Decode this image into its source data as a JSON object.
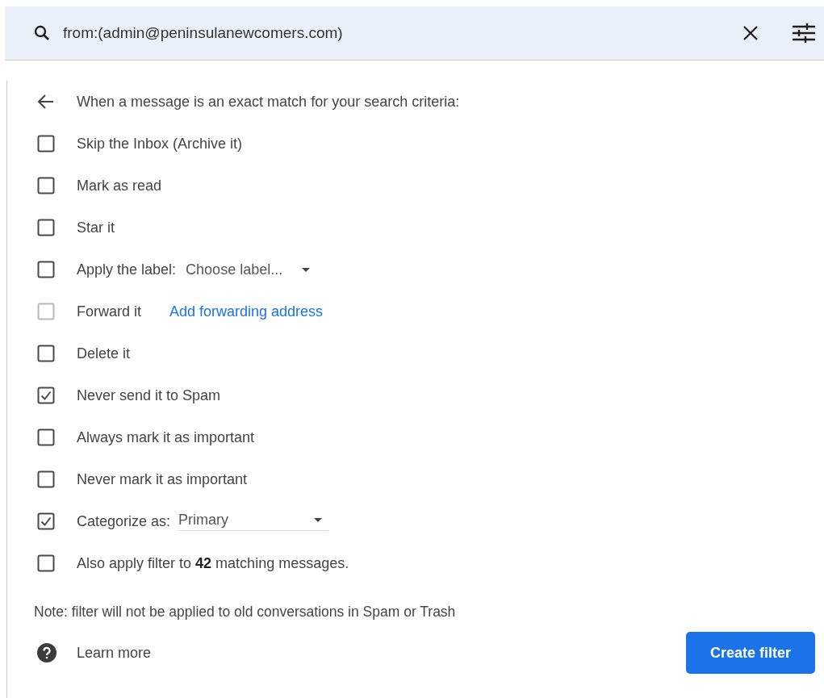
{
  "search": {
    "value": "from:(admin@peninsulanewcomers.com)"
  },
  "header": {
    "text": "When a message is an exact match for your search criteria:"
  },
  "options": [
    {
      "kind": "plain",
      "label": "Skip the Inbox (Archive it)",
      "checked": false,
      "disabled": false
    },
    {
      "kind": "plain",
      "label": "Mark as read",
      "checked": false,
      "disabled": false
    },
    {
      "kind": "plain",
      "label": "Star it",
      "checked": false,
      "disabled": false
    },
    {
      "kind": "select",
      "label": "Apply the label:",
      "value": "Choose label...",
      "checked": false,
      "disabled": false
    },
    {
      "kind": "link",
      "label": "Forward it",
      "link": "Add forwarding address",
      "checked": false,
      "disabled": true
    },
    {
      "kind": "plain",
      "label": "Delete it",
      "checked": false,
      "disabled": false
    },
    {
      "kind": "plain",
      "label": "Never send it to Spam",
      "checked": true,
      "disabled": false
    },
    {
      "kind": "plain",
      "label": "Always mark it as important",
      "checked": false,
      "disabled": false
    },
    {
      "kind": "plain",
      "label": "Never mark it as important",
      "checked": false,
      "disabled": false
    },
    {
      "kind": "underlined-select",
      "label": "Categorize as:",
      "value": "Primary",
      "checked": true,
      "disabled": false
    },
    {
      "kind": "rich",
      "label": "Also apply filter to **42** matching messages.",
      "checked": false,
      "disabled": false
    }
  ],
  "note": "Note: filter will not be applied to old conversations in Spam or Trash",
  "learn_more": "Learn more",
  "create_button": "Create filter"
}
